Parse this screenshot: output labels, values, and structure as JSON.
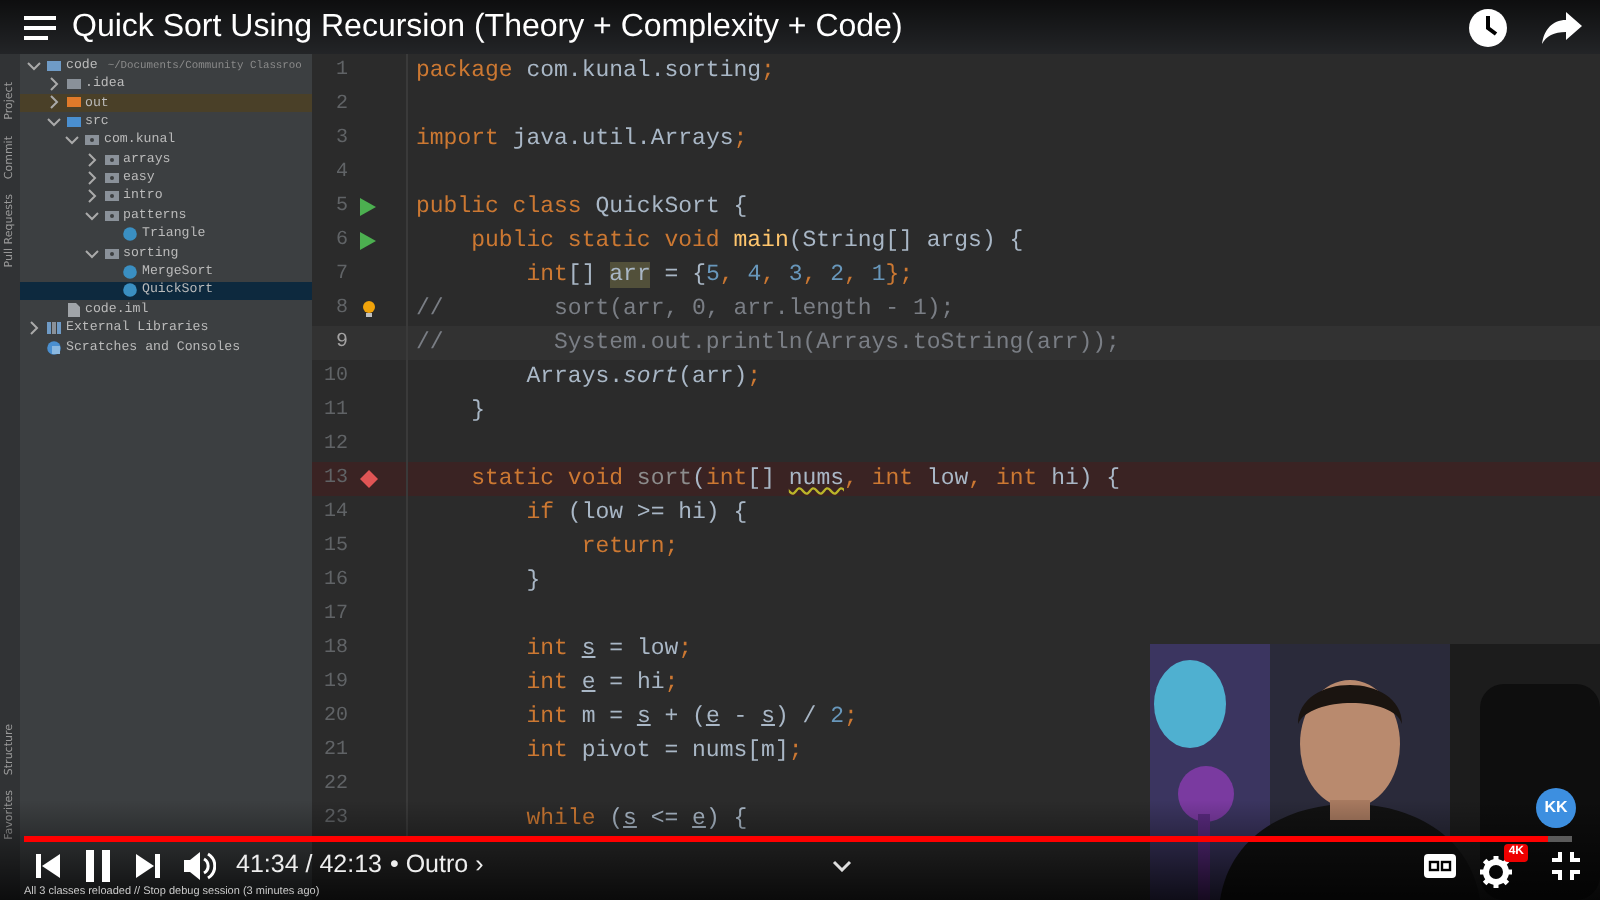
{
  "video_title": "Quick Sort Using Recursion (Theory + Complexity + Code)",
  "ide": {
    "tool_tabs_top": [
      "Project",
      "Commit",
      "Pull Requests"
    ],
    "tool_tabs_bottom": [
      "Structure",
      "Favorites"
    ],
    "project_path": "~/Documents/Community Classroo",
    "tree": [
      {
        "label": "code",
        "kind": "module",
        "expanded": true,
        "selected": false,
        "children": [
          {
            "label": ".idea",
            "kind": "folder",
            "expanded": false,
            "selected": false
          },
          {
            "label": "out",
            "kind": "excluded-folder",
            "expanded": false,
            "selected": false
          },
          {
            "label": "src",
            "kind": "source-folder",
            "expanded": true,
            "selected": false,
            "children": [
              {
                "label": "com.kunal",
                "kind": "package",
                "expanded": true,
                "selected": false,
                "children": [
                  {
                    "label": "arrays",
                    "kind": "package",
                    "expanded": false,
                    "selected": false
                  },
                  {
                    "label": "easy",
                    "kind": "package",
                    "expanded": false,
                    "selected": false
                  },
                  {
                    "label": "intro",
                    "kind": "package",
                    "expanded": false,
                    "selected": false
                  },
                  {
                    "label": "patterns",
                    "kind": "package",
                    "expanded": true,
                    "selected": false,
                    "children": [
                      {
                        "label": "Triangle",
                        "kind": "class",
                        "selected": false
                      }
                    ]
                  },
                  {
                    "label": "sorting",
                    "kind": "package",
                    "expanded": true,
                    "selected": false,
                    "children": [
                      {
                        "label": "MergeSort",
                        "kind": "class",
                        "selected": false
                      },
                      {
                        "label": "QuickSort",
                        "kind": "class",
                        "selected": true
                      }
                    ]
                  }
                ]
              }
            ]
          },
          {
            "label": "code.iml",
            "kind": "file",
            "selected": false
          }
        ]
      },
      {
        "label": "External Libraries",
        "kind": "library",
        "expanded": false,
        "selected": false
      },
      {
        "label": "Scratches and Consoles",
        "kind": "scratches",
        "selected": false
      }
    ],
    "code_lines": [
      {
        "number": "1",
        "tokens": [
          {
            "text": "package",
            "kind": "kw"
          },
          {
            "text": " com.kunal.sorting",
            "kind": "plain"
          },
          {
            "text": ";",
            "kind": "kw"
          }
        ]
      },
      {
        "number": "2"
      },
      {
        "number": "3",
        "tokens": [
          {
            "text": "import",
            "kind": "kw"
          },
          {
            "text": " java.util.Arrays",
            "kind": "plain"
          },
          {
            "text": ";",
            "kind": "kw"
          }
        ]
      },
      {
        "number": "4"
      },
      {
        "number": "5",
        "kind": "run",
        "tokens": [
          {
            "text": "public class",
            "kind": "kw"
          },
          {
            "text": " QuickSort {",
            "kind": "plain"
          }
        ]
      },
      {
        "number": "6",
        "kind": "run",
        "tokens": [
          {
            "text": "    public static void ",
            "kind": "kw"
          },
          {
            "text": "main",
            "kind": "fn"
          },
          {
            "text": "(String[] args) {",
            "kind": "plain"
          }
        ]
      },
      {
        "number": "7",
        "tokens": [
          {
            "text": "        int",
            "kind": "kw"
          },
          {
            "text": "[] ",
            "kind": "plain"
          },
          {
            "text": "arr",
            "kind": "hl"
          },
          {
            "text": " = {",
            "kind": "plain"
          },
          {
            "text": "5",
            "kind": "num"
          },
          {
            "text": ", ",
            "kind": "kw"
          },
          {
            "text": "4",
            "kind": "num"
          },
          {
            "text": ", ",
            "kind": "kw"
          },
          {
            "text": "3",
            "kind": "num"
          },
          {
            "text": ", ",
            "kind": "kw"
          },
          {
            "text": "2",
            "kind": "num"
          },
          {
            "text": ", ",
            "kind": "kw"
          },
          {
            "text": "1",
            "kind": "num"
          },
          {
            "text": "};",
            "kind": "kw"
          }
        ]
      },
      {
        "number": "8",
        "kind": "bulb",
        "tokens": [
          {
            "text": "//        sort(arr, 0, arr.length - 1);",
            "kind": "comment"
          }
        ]
      },
      {
        "number": "9",
        "kind": "current",
        "tokens": [
          {
            "text": "//        System.out.println(Arrays.toString(arr));",
            "kind": "comment"
          }
        ]
      },
      {
        "number": "10",
        "tokens": [
          {
            "text": "        Arrays.",
            "kind": "plain"
          },
          {
            "text": "sort",
            "kind": "static"
          },
          {
            "text": "(arr)",
            "kind": "plain"
          },
          {
            "text": ";",
            "kind": "kw"
          }
        ]
      },
      {
        "number": "11",
        "tokens": [
          {
            "text": "    }",
            "kind": "plain"
          }
        ]
      },
      {
        "number": "12"
      },
      {
        "number": "13",
        "kind": "breakpoint",
        "tokens": [
          {
            "text": "    static void",
            "kind": "kw"
          },
          {
            "text": " sort",
            "kind": "dim"
          },
          {
            "text": "(",
            "kind": "plain"
          },
          {
            "text": "int",
            "kind": "kw"
          },
          {
            "text": "[] ",
            "kind": "plain"
          },
          {
            "text": "nums",
            "kind": "warn"
          },
          {
            "text": ", ",
            "kind": "kw"
          },
          {
            "text": "int",
            "kind": "kw"
          },
          {
            "text": " low",
            "kind": "plain"
          },
          {
            "text": ", ",
            "kind": "kw"
          },
          {
            "text": "int",
            "kind": "kw"
          },
          {
            "text": " hi) {",
            "kind": "plain"
          }
        ]
      },
      {
        "number": "14",
        "tokens": [
          {
            "text": "        if",
            "kind": "kw"
          },
          {
            "text": " (low >= hi) {",
            "kind": "plain"
          }
        ]
      },
      {
        "number": "15",
        "tokens": [
          {
            "text": "            return;",
            "kind": "kw"
          }
        ]
      },
      {
        "number": "16",
        "tokens": [
          {
            "text": "        }",
            "kind": "plain"
          }
        ]
      },
      {
        "number": "17"
      },
      {
        "number": "18",
        "tokens": [
          {
            "text": "        int ",
            "kind": "kw"
          },
          {
            "text": "s",
            "kind": "var"
          },
          {
            "text": " = low",
            "kind": "plain"
          },
          {
            "text": ";",
            "kind": "kw"
          }
        ]
      },
      {
        "number": "19",
        "tokens": [
          {
            "text": "        int ",
            "kind": "kw"
          },
          {
            "text": "e",
            "kind": "var"
          },
          {
            "text": " = hi",
            "kind": "plain"
          },
          {
            "text": ";",
            "kind": "kw"
          }
        ]
      },
      {
        "number": "20",
        "tokens": [
          {
            "text": "        int",
            "kind": "kw"
          },
          {
            "text": " m = ",
            "kind": "plain"
          },
          {
            "text": "s",
            "kind": "var"
          },
          {
            "text": " + (",
            "kind": "plain"
          },
          {
            "text": "e",
            "kind": "var"
          },
          {
            "text": " - ",
            "kind": "plain"
          },
          {
            "text": "s",
            "kind": "var"
          },
          {
            "text": ") / ",
            "kind": "plain"
          },
          {
            "text": "2",
            "kind": "num"
          },
          {
            "text": ";",
            "kind": "kw"
          }
        ]
      },
      {
        "number": "21",
        "tokens": [
          {
            "text": "        int",
            "kind": "kw"
          },
          {
            "text": " pivot = nums[m]",
            "kind": "plain"
          },
          {
            "text": ";",
            "kind": "kw"
          }
        ]
      },
      {
        "number": "22"
      },
      {
        "number": "23",
        "tokens": [
          {
            "text": "        while",
            "kind": "kw"
          },
          {
            "text": " (",
            "kind": "plain"
          },
          {
            "text": "s",
            "kind": "var"
          },
          {
            "text": " <= ",
            "kind": "plain"
          },
          {
            "text": "e",
            "kind": "var"
          },
          {
            "text": ") {",
            "kind": "plain"
          }
        ]
      }
    ],
    "status": "All 3 classes reloaded // Stop debug session (3 minutes ago)"
  },
  "player": {
    "progress": {
      "level": 0.985
    },
    "time": "41:34 / 42:13",
    "chapter": "• Outro",
    "chapter_arrow": "›",
    "channel_badge": "KK",
    "quality_badge": "4K"
  }
}
